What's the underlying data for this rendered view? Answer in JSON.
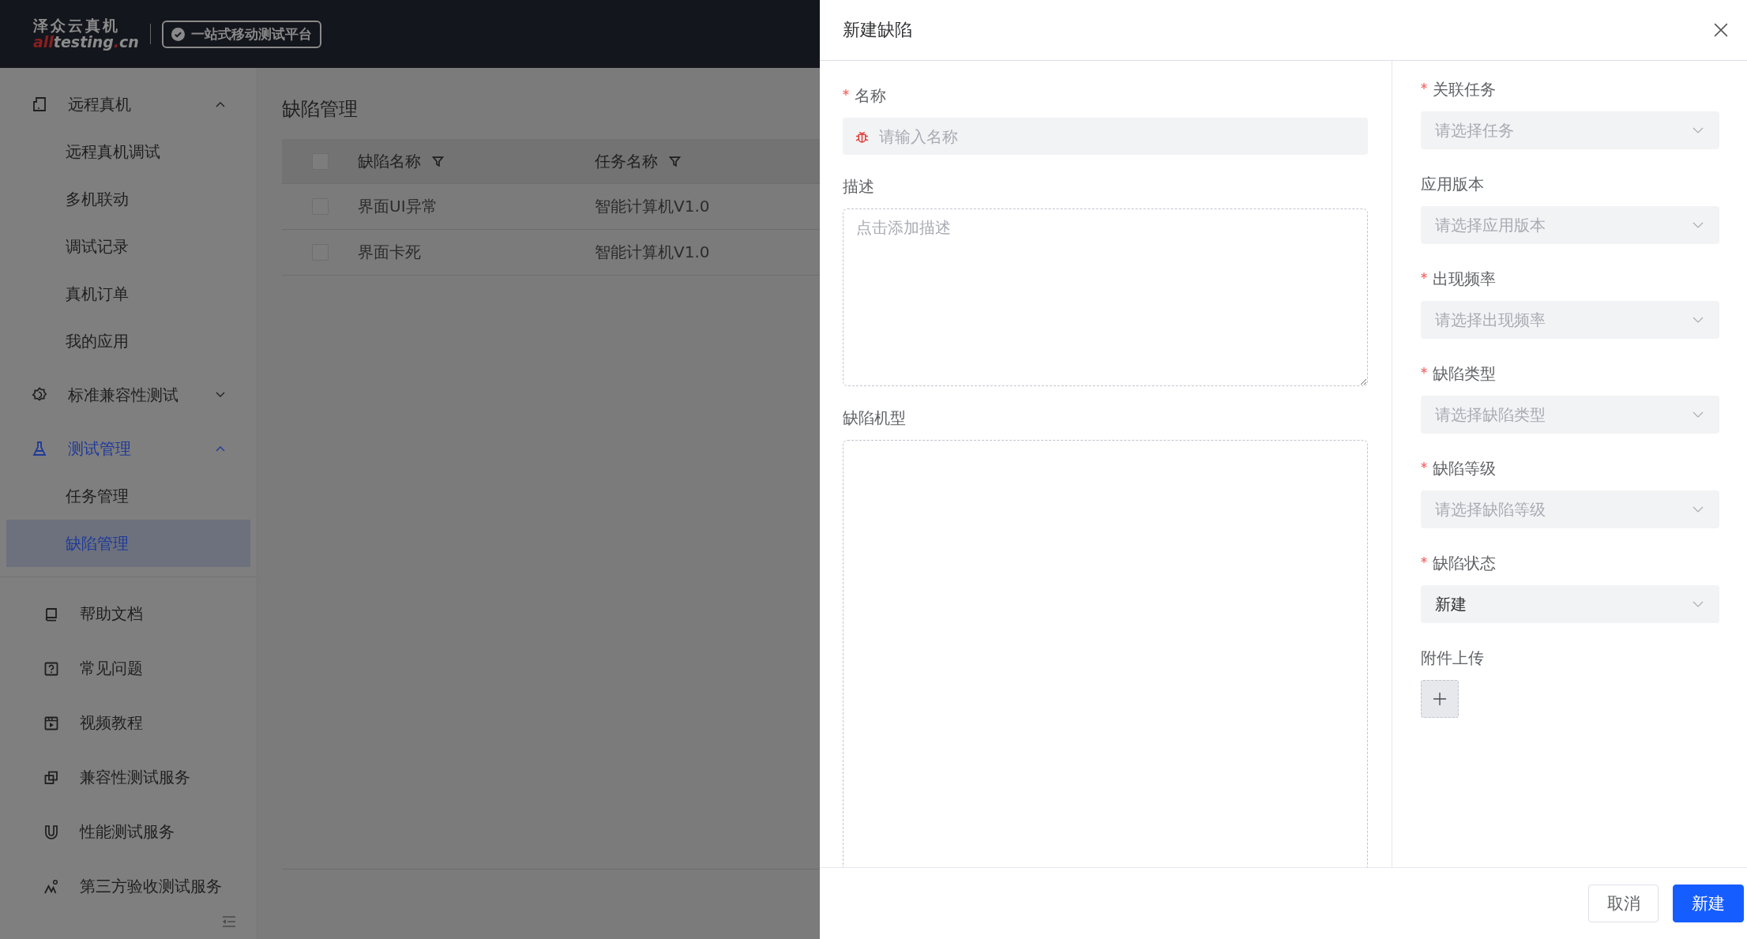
{
  "header": {
    "logo": {
      "title": "泽众云真机",
      "domain": [
        {
          "text": "all",
          "accent": true
        },
        {
          "text": "testing",
          "accent": false
        },
        {
          "text": ".",
          "accent": true
        },
        {
          "text": "cn",
          "accent": false
        }
      ]
    },
    "badge": "一站式移动测试平台"
  },
  "sidebar": {
    "groups": [
      {
        "label": "远程真机",
        "expanded": true,
        "selected": false,
        "children": [
          {
            "label": "远程真机调试",
            "selected": false
          },
          {
            "label": "多机联动",
            "selected": false
          },
          {
            "label": "调试记录",
            "selected": false
          },
          {
            "label": "真机订单",
            "selected": false
          },
          {
            "label": "我的应用",
            "selected": false
          }
        ]
      },
      {
        "label": "标准兼容性测试",
        "expanded": false,
        "selected": false
      },
      {
        "label": "测试管理",
        "expanded": true,
        "selected": true,
        "children": [
          {
            "label": "任务管理",
            "selected": false
          },
          {
            "label": "缺陷管理",
            "selected": true
          }
        ]
      }
    ],
    "links": [
      "帮助文档",
      "常见问题",
      "视频教程",
      "兼容性测试服务",
      "性能测试服务",
      "第三方验收测试服务"
    ]
  },
  "page": {
    "title": "缺陷管理",
    "table": {
      "all_checked": false,
      "columns": [
        "缺陷名称",
        "任务名称"
      ],
      "rows": [
        {
          "checked": false,
          "cells": [
            "界面UI异常",
            "智能计算机V1.0"
          ]
        },
        {
          "checked": false,
          "cells": [
            "界面卡死",
            "智能计算机V1.0"
          ]
        }
      ]
    }
  },
  "drawer": {
    "title": "新建缺陷",
    "left_fields": [
      {
        "kind": "input",
        "label": "名称",
        "required": true,
        "placeholder": "请输入名称"
      },
      {
        "kind": "textarea",
        "label": "描述",
        "required": false,
        "placeholder": "点击添加描述"
      },
      {
        "kind": "area",
        "label": "缺陷机型",
        "required": false
      }
    ],
    "right_fields": [
      {
        "kind": "select",
        "label": "关联任务",
        "required": true,
        "placeholder": "请选择任务"
      },
      {
        "kind": "select",
        "label": "应用版本",
        "required": false,
        "placeholder": "请选择应用版本"
      },
      {
        "kind": "select",
        "label": "出现频率",
        "required": true,
        "placeholder": "请选择出现频率"
      },
      {
        "kind": "select",
        "label": "缺陷类型",
        "required": true,
        "placeholder": "请选择缺陷类型"
      },
      {
        "kind": "select",
        "label": "缺陷等级",
        "required": true,
        "placeholder": "请选择缺陷等级"
      },
      {
        "kind": "select",
        "label": "缺陷状态",
        "required": true,
        "value": "新建"
      },
      {
        "kind": "upload",
        "label": "附件上传",
        "required": false
      }
    ],
    "buttons": {
      "cancel": "取消",
      "submit": "新建"
    }
  }
}
